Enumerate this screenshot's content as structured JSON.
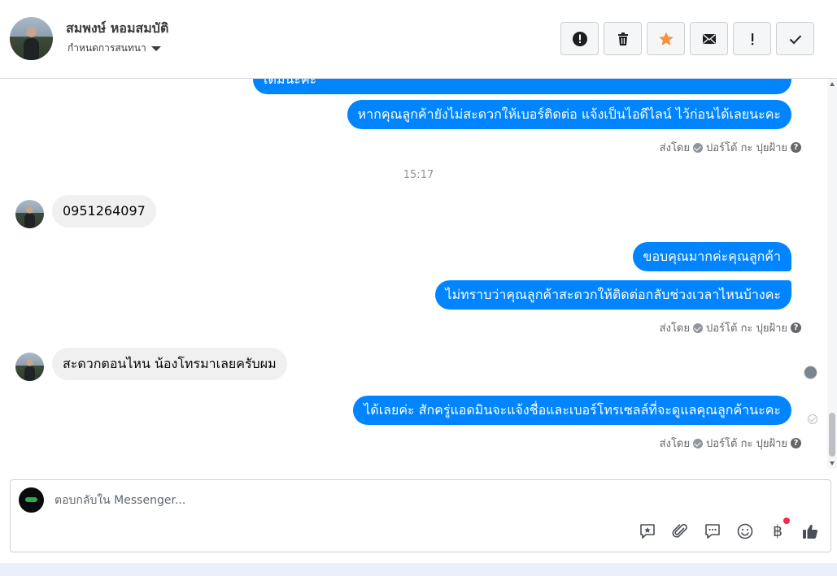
{
  "header": {
    "contact_name": "สมพงษ์ หอมสมบัติ",
    "assign_label": "กำหนดการสนทนา",
    "actions": [
      {
        "name": "spam-report-button",
        "icon": "alert-circle-icon"
      },
      {
        "name": "delete-button",
        "icon": "trash-icon"
      },
      {
        "name": "star-button",
        "icon": "star-icon"
      },
      {
        "name": "mark-unread-button",
        "icon": "envelope-icon"
      },
      {
        "name": "follow-up-button",
        "icon": "exclamation-icon"
      },
      {
        "name": "mark-done-button",
        "icon": "checkmark-icon"
      }
    ],
    "accent_star": "#f7923b"
  },
  "chat": {
    "partial_top": "เติมนะคะ",
    "msg_out_1": "หากคุณลูกค้ายังไม่สะดวกให้เบอร์ติดต่อ แจ้งเป็นไอดีไลน์ ไว้ก่อนได้เลยนะคะ",
    "sent_by_label": "ส่งโดย",
    "sent_by_name": "ปอร์โต้ กะ ปุยฝ้าย",
    "time_1": "15:17",
    "msg_in_1": "0951264097",
    "msg_out_2": "ขอบคุณมากค่ะคุณลูกค้า",
    "msg_out_3": "ไม่ทราบว่าคุณลูกค้าสะดวกให้ติดต่อกลับช่วงเวลาไหนบ้างคะ",
    "msg_in_2": "สะดวกตอนไหน  น้องโทรมาเลยครับผม",
    "msg_out_4": "ได้เลยค่ะ สักครู่แอดมินจะแจ้งชื่อและเบอร์โทรเซลล์ที่จะดูแลคุณลูกค้านะคะ",
    "bubble_color": "#0084ff"
  },
  "reply": {
    "placeholder": "ตอบกลับใน Messenger...",
    "tools": [
      "saved-reply-icon",
      "attachment-icon",
      "chat-bubble-icon",
      "emoji-icon",
      "baht-payment-icon",
      "like-icon"
    ]
  }
}
